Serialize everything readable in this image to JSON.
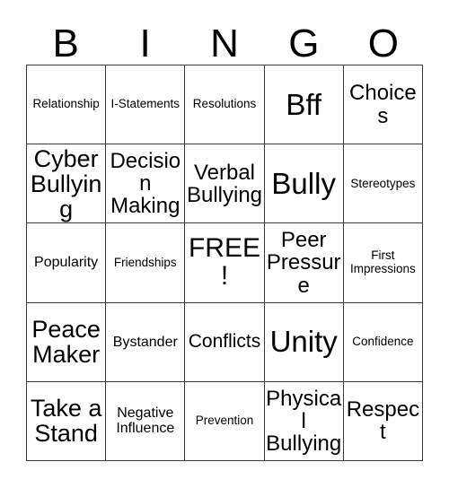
{
  "card": {
    "title": "BINGO",
    "header_letters": [
      "B",
      "I",
      "N",
      "G",
      "O"
    ],
    "free_space_label": "FREE!",
    "colors": {
      "background": "#ffffff",
      "border": "#3a3a3a",
      "text": "#000000"
    },
    "rows": [
      [
        {
          "label": "Relationship",
          "size": "sm"
        },
        {
          "label": "I-Statements",
          "size": "sm"
        },
        {
          "label": "Resolutions",
          "size": "sm"
        },
        {
          "label": "Bff",
          "size": "4xl"
        },
        {
          "label": "Choices",
          "size": "xl"
        }
      ],
      [
        {
          "label": "Cyber Bullying",
          "size": "2xl"
        },
        {
          "label": "Decision Making",
          "size": "xl"
        },
        {
          "label": "Verbal Bullying",
          "size": "xl"
        },
        {
          "label": "Bully",
          "size": "4xl"
        },
        {
          "label": "Stereotypes",
          "size": "sm"
        }
      ],
      [
        {
          "label": "Popularity",
          "size": "md"
        },
        {
          "label": "Friendships",
          "size": "sm"
        },
        {
          "label": "FREE!",
          "size": "3xl"
        },
        {
          "label": "Peer Pressure",
          "size": "xl"
        },
        {
          "label": "First Impressions",
          "size": "sm"
        }
      ],
      [
        {
          "label": "Peace Maker",
          "size": "2xl"
        },
        {
          "label": "Bystander",
          "size": "md"
        },
        {
          "label": "Conflicts",
          "size": "lg"
        },
        {
          "label": "Unity",
          "size": "4xl"
        },
        {
          "label": "Confidence",
          "size": "sm"
        }
      ],
      [
        {
          "label": "Take a Stand",
          "size": "2xl"
        },
        {
          "label": "Negative Influence",
          "size": "md"
        },
        {
          "label": "Prevention",
          "size": "sm"
        },
        {
          "label": "Physical Bullying",
          "size": "xl"
        },
        {
          "label": "Respect",
          "size": "xl"
        }
      ]
    ]
  }
}
